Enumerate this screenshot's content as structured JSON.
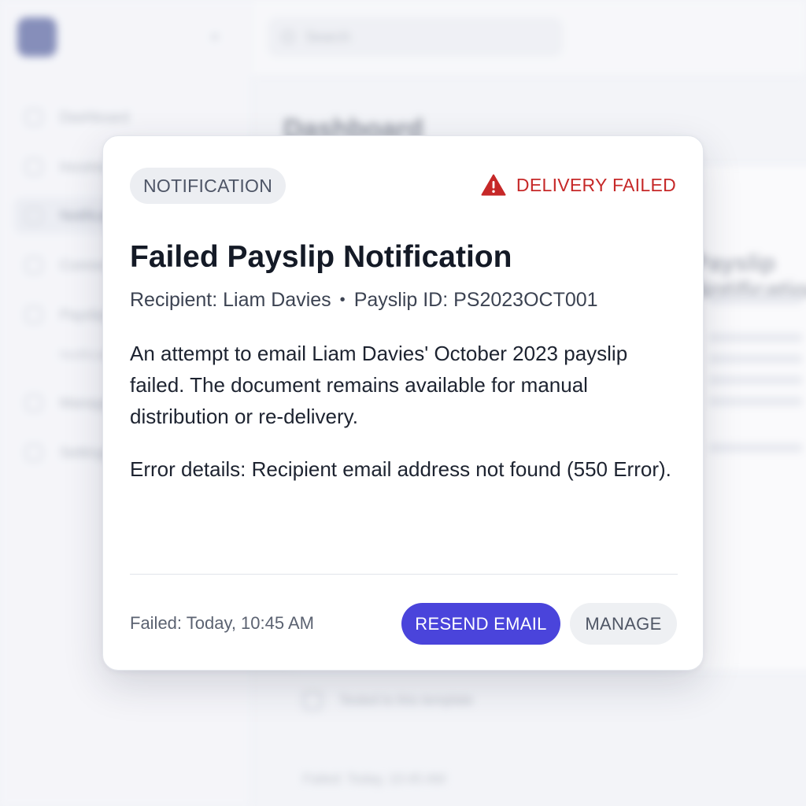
{
  "background": {
    "search_placeholder": "Search",
    "page_title": "Dashboard",
    "sidebar_items": [
      {
        "label": "Dashboard",
        "icon": "home-icon"
      },
      {
        "label": "Income",
        "icon": "grid-icon"
      },
      {
        "label": "Notifications",
        "icon": "mail-icon"
      },
      {
        "label": "Connections",
        "icon": "link-icon"
      },
      {
        "label": "Payslips",
        "icon": "send-icon"
      },
      {
        "label": "Manage",
        "icon": "settings-icon"
      },
      {
        "label": "Settings",
        "icon": "gear-icon"
      }
    ],
    "sidebar_subitem": "Notifications",
    "card_title": "Payslip Notification",
    "list_item": "Tested to this template",
    "footer_time": "Failed: Today, 10:45 AM"
  },
  "notification": {
    "badge": "NOTIFICATION",
    "status_label": "DELIVERY FAILED",
    "status_icon": "warning-triangle-icon",
    "status_color": "#c62828",
    "title": "Failed Payslip Notification",
    "recipient": "Recipient: Liam Davies",
    "separator": "•",
    "payslip_id": "Payslip ID: PS2023OCT001",
    "description": "An attempt to email Liam Davies' October 2023 payslip failed. The document remains available for manual distribution or re-delivery.",
    "error_details": "Error details: Recipient email address not found (550 Error).",
    "timestamp": "Failed: Today, 10:45 AM",
    "primary_action": "RESEND EMAIL",
    "secondary_action": "MANAGE",
    "accent_color": "#4a44db"
  }
}
